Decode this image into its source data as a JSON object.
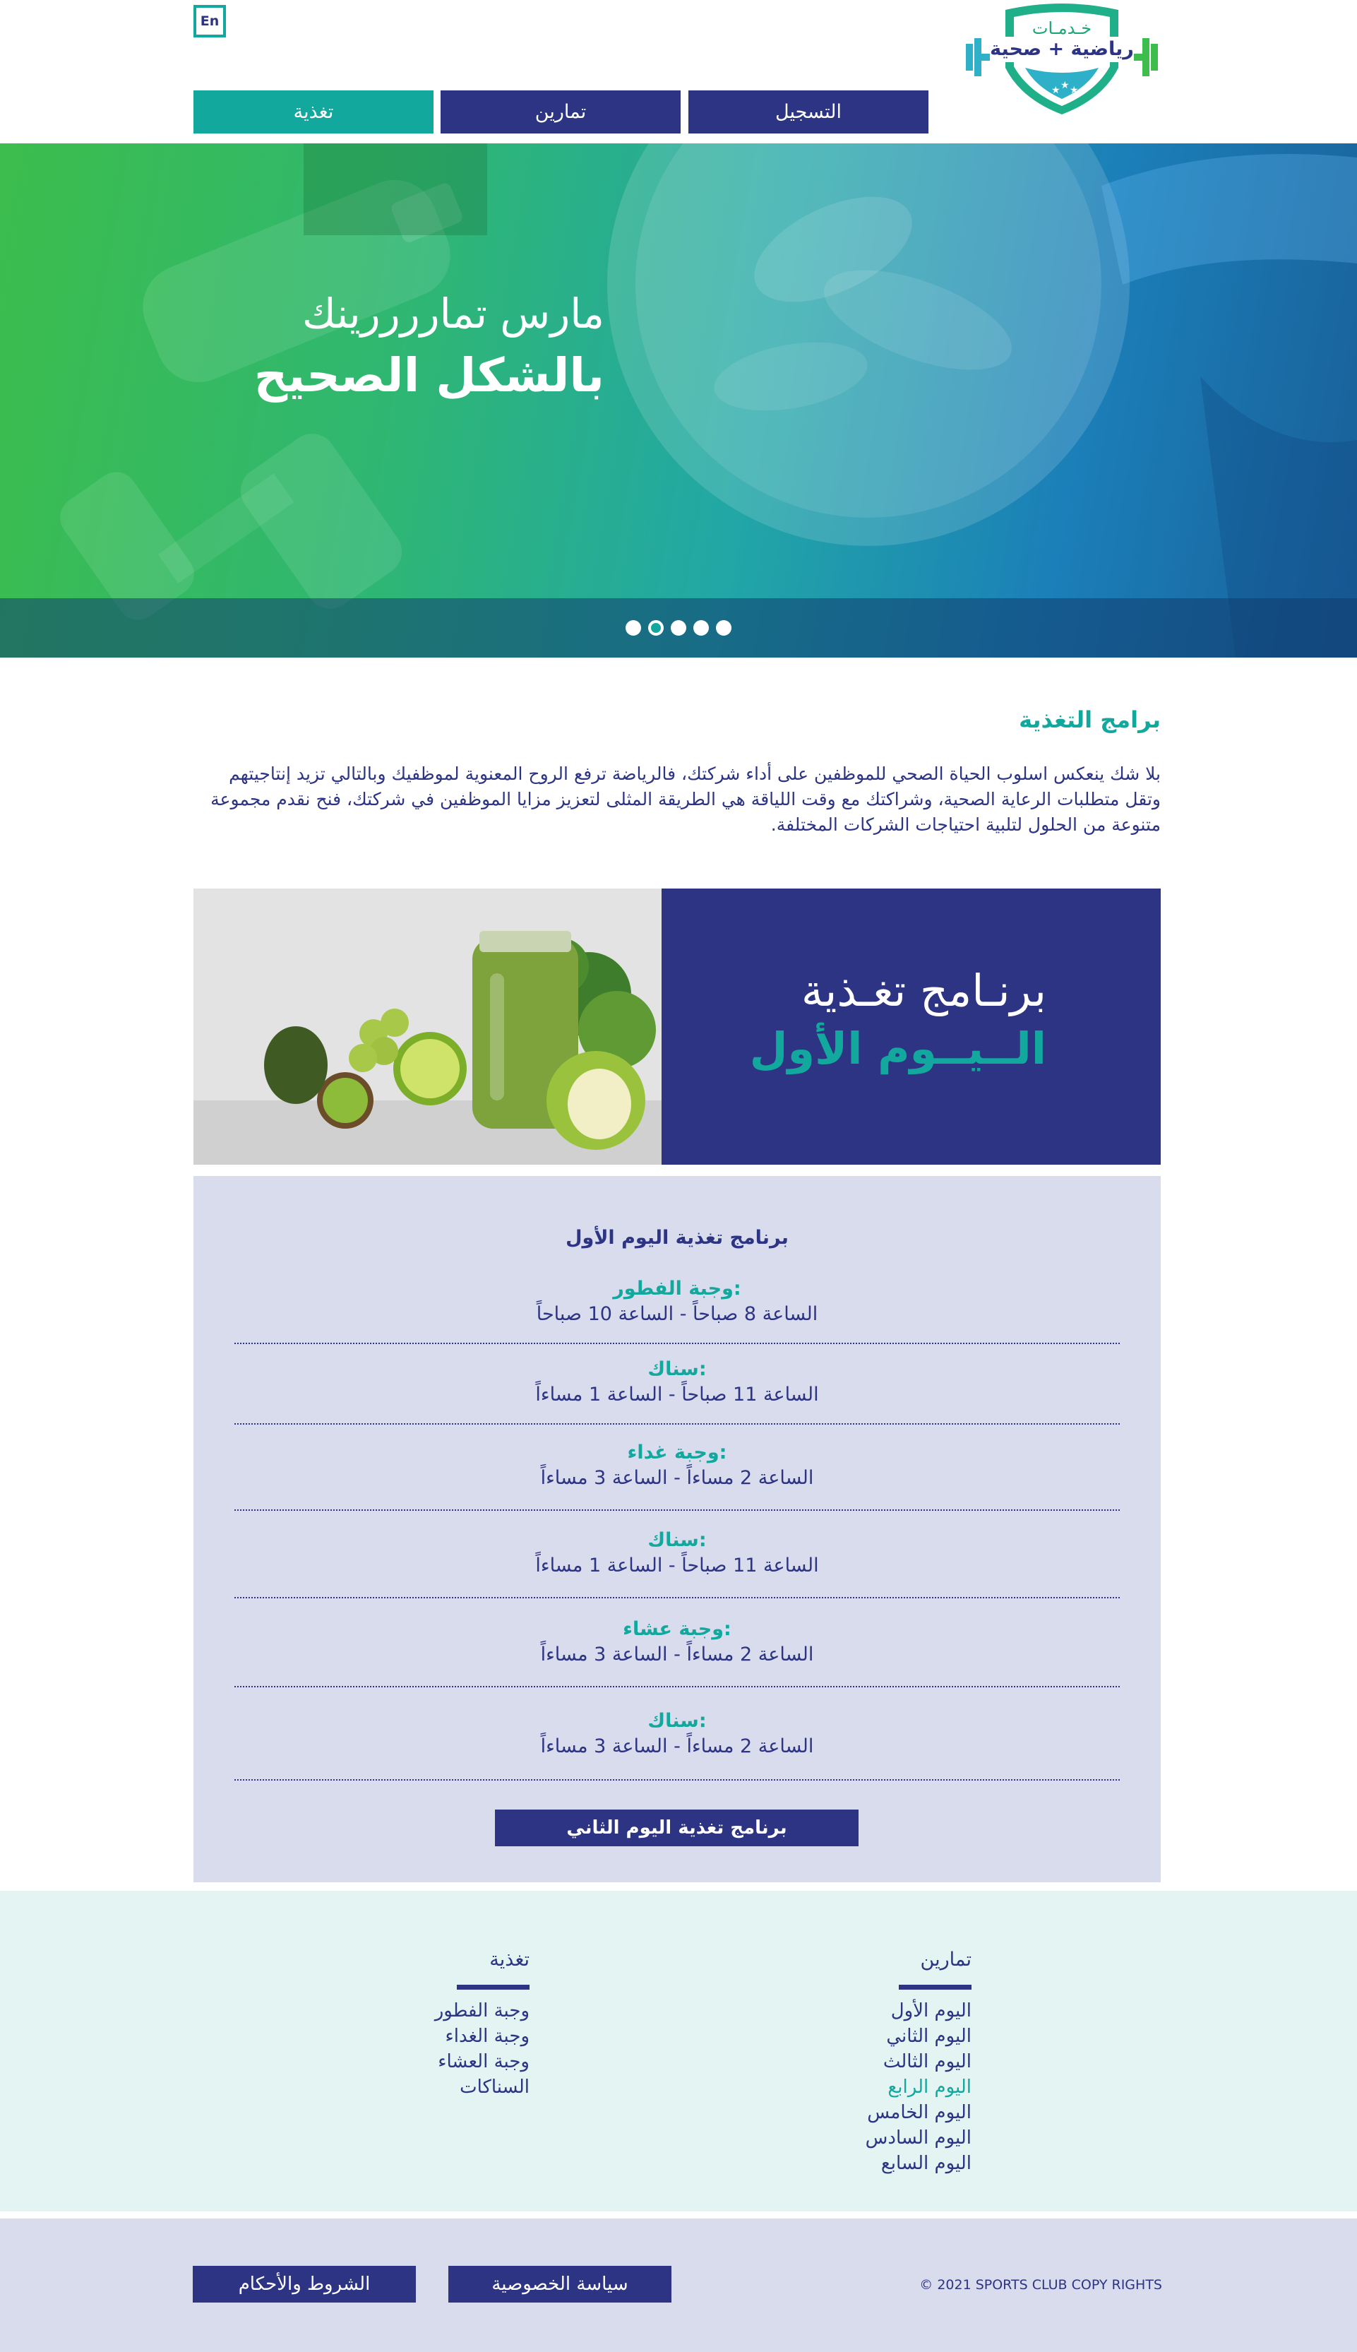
{
  "header": {
    "lang_toggle": "En",
    "logo_line_1": "خـدمـات",
    "logo_line_2": "رياضية + صحية",
    "nav": {
      "nutrition": "تغذية",
      "exercises": "تمارين",
      "register": "التسجيل"
    }
  },
  "hero": {
    "title_line_1": "مارس تماررررينك",
    "title_line_2": "بالشكل الصحيح",
    "dots_count": 5,
    "active_dot_index": 1
  },
  "intro": {
    "heading": "برامج التغذية",
    "text": "بلا شك ينعكس اسلوب الحياة الصحي للموظفين على أداء شركتك، فالرياضة ترفع الروح المعنوية لموظفيك وبالتالي تزيد إنتاجيتهم وتقل متطلبات الرعاية الصحية، وشراكتك مع وقت اللياقة هي الطريقة المثلى لتعزيز مزايا الموظفين في شركتك، فنح نقدم مجموعة متنوعة من الحلول لتلبية احتياجات الشركات المختلفة."
  },
  "banner": {
    "title_line_1": "برنـامج تغـذية",
    "title_line_2": "الــيــوم الأول"
  },
  "schedule": {
    "title": "برنامج تغذية اليوم الأول",
    "meals": [
      {
        "name": "وجبة الفطور:",
        "time": "الساعة 8 صباحاً - الساعة 10 صباحاً"
      },
      {
        "name": "سناك:",
        "time": "الساعة 11 صباحاً - الساعة 1 مساءاً"
      },
      {
        "name": "وجبة غداء:",
        "time": "الساعة 2 مساءاً - الساعة 3 مساءاً"
      },
      {
        "name": "سناك:",
        "time": "الساعة 11 صباحاً - الساعة 1 مساءاً"
      },
      {
        "name": "وجبة عشاء:",
        "time": "الساعة 2 مساءاً - الساعة 3 مساءاً"
      },
      {
        "name": "سناك:",
        "time": "الساعة 2 مساءاً - الساعة 3 مساءاً"
      }
    ],
    "next_button": "برنامج تغذية اليوم الثاني"
  },
  "footer": {
    "exercises": {
      "title": "تمارين",
      "links": [
        "اليوم الأول",
        "اليوم الثاني",
        "اليوم الثالث",
        "اليوم الرابع",
        "اليوم الخامس",
        "اليوم السادس",
        "اليوم السابع"
      ],
      "active_index": 3
    },
    "nutrition": {
      "title": "تغذية",
      "links": [
        "وجبة الفطور",
        "وجبة الغداء",
        "وجبة العشاء",
        "السناكات"
      ]
    },
    "terms_button": "الشروط والأحكام",
    "privacy_button": "سياسة الخصوصية",
    "copyright": "© 2021 SPORTS CLUB COPY RIGHTS"
  },
  "colors": {
    "primary": "#2c3483",
    "accent": "#13a89e",
    "schedule_bg": "#d9dced",
    "footer_bg": "#e3f4f3"
  }
}
